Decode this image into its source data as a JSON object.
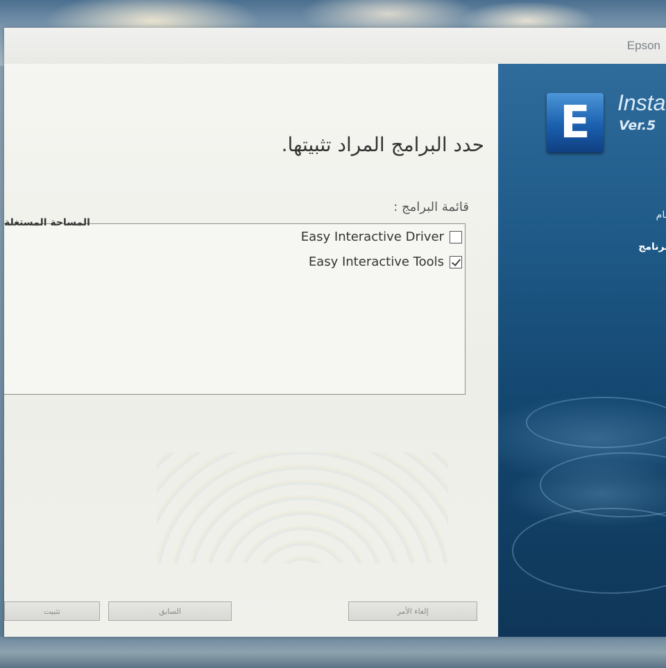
{
  "window": {
    "title": "Epson"
  },
  "main": {
    "heading": "حدد البرامج المراد تثبيتها.",
    "list_label": "قائمة البرامج :",
    "space_column_header": "المساحة المستغلة",
    "programs": [
      {
        "name": "Easy Interactive Driver",
        "checked": false
      },
      {
        "name": "Easy Interactive Tools",
        "checked": true
      }
    ]
  },
  "buttons": {
    "install": "تثبيت",
    "back": "السابق",
    "cancel": "إلغاء الأمر"
  },
  "banner": {
    "logo_letter": "E",
    "title": "Insta",
    "version": "Ver.5",
    "step_1": "نظام",
    "step_2": "البرنامج"
  }
}
